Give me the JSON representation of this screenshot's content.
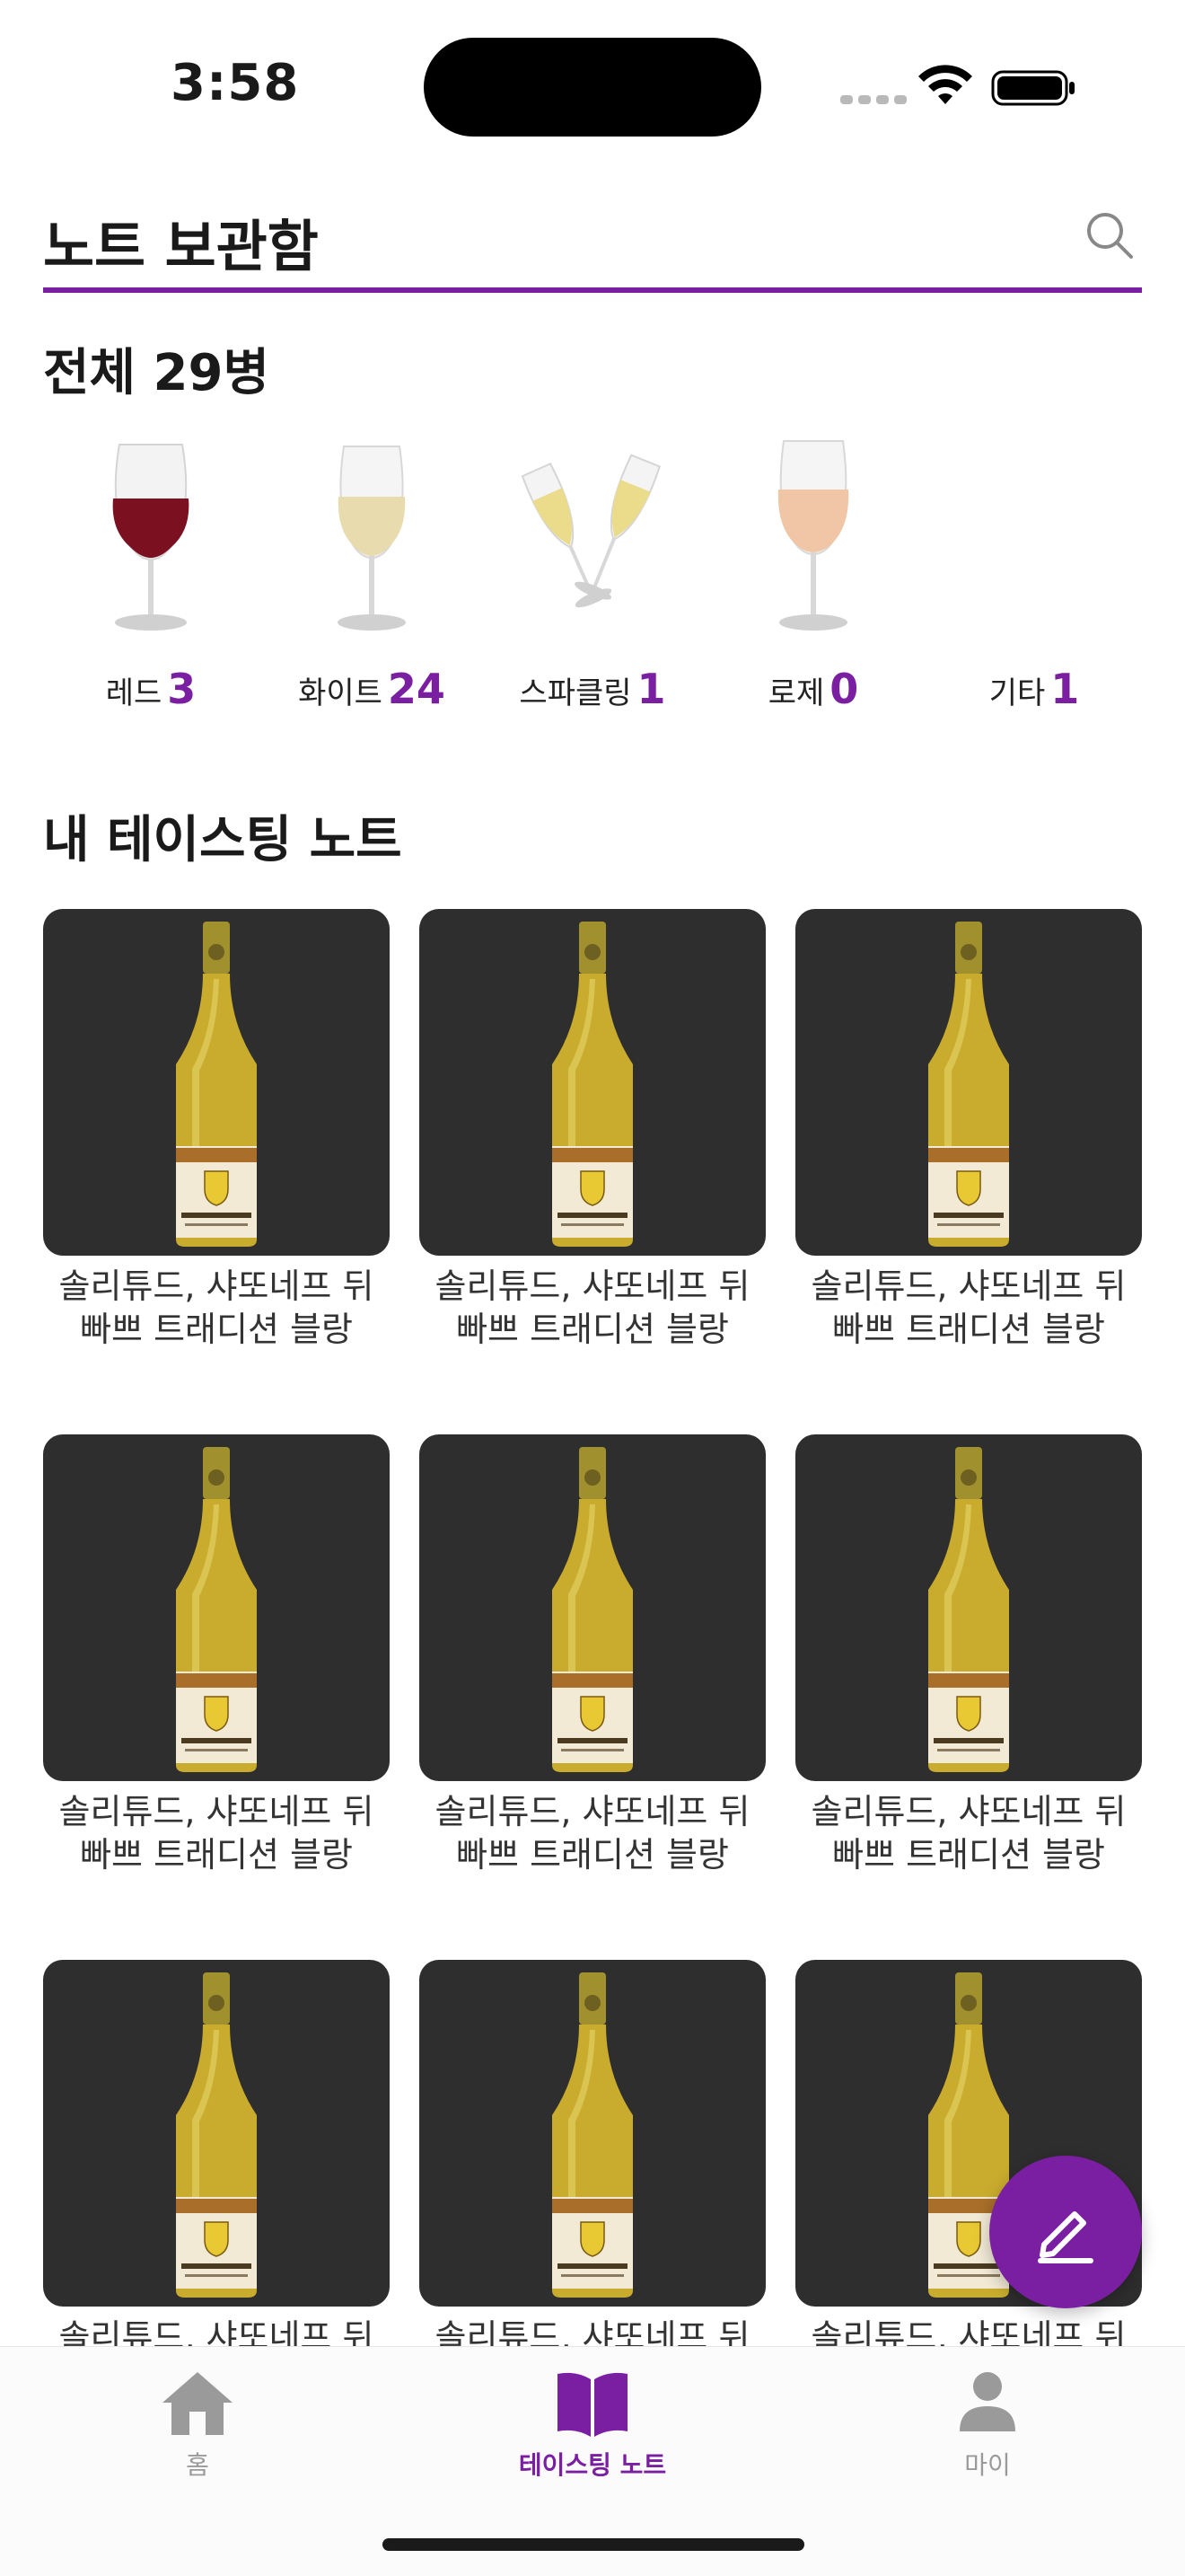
{
  "status_bar": {
    "time": "3:58"
  },
  "header": {
    "title": "노트 보관함"
  },
  "summary": {
    "title": "전체 29병",
    "categories": [
      {
        "name": "레드",
        "count": "3",
        "icon": "red-wine-glass-icon",
        "color": "#7a1020"
      },
      {
        "name": "화이트",
        "count": "24",
        "icon": "white-wine-glass-icon",
        "color": "#e8dcae"
      },
      {
        "name": "스파클링",
        "count": "1",
        "icon": "sparkling-toast-icon",
        "color": "#eadc8a"
      },
      {
        "name": "로제",
        "count": "0",
        "icon": "rose-wine-glass-icon",
        "color": "#f0c6a6"
      },
      {
        "name": "기타",
        "count": "1",
        "icon": "",
        "color": ""
      }
    ]
  },
  "notes": {
    "title": "내 테이스팅 노트",
    "items": [
      {
        "name": "솔리튜드, 샤또네프 뒤 빠쁘 트래디션 블랑"
      },
      {
        "name": "솔리튜드, 샤또네프 뒤 빠쁘 트래디션 블랑"
      },
      {
        "name": "솔리튜드, 샤또네프 뒤 빠쁘 트래디션 블랑"
      },
      {
        "name": "솔리튜드, 샤또네프 뒤 빠쁘 트래디션 블랑"
      },
      {
        "name": "솔리튜드, 샤또네프 뒤 빠쁘 트래디션 블랑"
      },
      {
        "name": "솔리튜드, 샤또네프 뒤 빠쁘 트래디션 블랑"
      },
      {
        "name": "솔리튜드, 샤또네프 뒤 빠쁘 트래디션 블랑"
      },
      {
        "name": "솔리튜드, 샤또네프 뒤 빠쁘 트래디션 블랑"
      },
      {
        "name": "솔리튜드, 샤또네프 뒤 빠쁘 트래디션 블랑"
      }
    ]
  },
  "fab": {
    "icon": "pencil-icon"
  },
  "tab_bar": {
    "tabs": [
      {
        "label": "홈",
        "icon": "home-icon",
        "active": false
      },
      {
        "label": "테이스팅 노트",
        "icon": "book-icon",
        "active": true
      },
      {
        "label": "마이",
        "icon": "person-icon",
        "active": false
      }
    ]
  },
  "colors": {
    "accent": "#7b1fa2",
    "card_bg": "#2e2e2e",
    "text": "#1a1a1a"
  }
}
